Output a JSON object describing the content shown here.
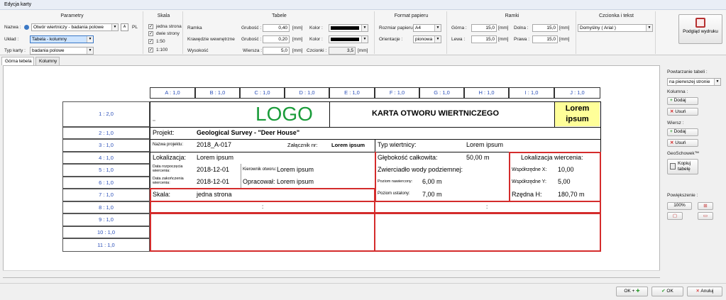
{
  "window": {
    "title": "Edycja karty"
  },
  "parametry": {
    "title": "Parametry",
    "nazwa_label": "Nazwa :",
    "nazwa_value": "Otwór wiertniczy - badania polowe",
    "pl": "PL",
    "uklad_label": "Układ :",
    "uklad_value": "Tabela - kolumny",
    "typ_label": "Typ karty :",
    "typ_value": "badania polowe"
  },
  "skala": {
    "title": "Skala",
    "items": [
      {
        "label": "jedna strona",
        "checked": true
      },
      {
        "label": "dwie strony",
        "checked": true
      },
      {
        "label": "1:50",
        "checked": true
      },
      {
        "label": "1:100",
        "checked": true
      }
    ]
  },
  "tabele": {
    "title": "Tabele",
    "ramka": "Ramka",
    "krawedzie": "Krawędzie wewnętrzne",
    "wysokosc": "Wysokość",
    "grubosc_label": "Grubość :",
    "grubosc1": "0,40",
    "grubosc2": "0,20",
    "wiersza_label": "Wiersza :",
    "wiersza": "5,0",
    "unit": "[mm]",
    "kolor_label": "Kolor :",
    "czcionki_label": "Czcionki :",
    "czcionki": "3,5",
    "color": "#000000"
  },
  "format": {
    "title": "Format papieru",
    "rozmiar_label": "Rozmiar papieru :",
    "rozmiar": "A4",
    "orientacja_label": "Orientacje :",
    "orientacja": "pionowa"
  },
  "ramki": {
    "title": "Ramki",
    "gora_label": "Górna :",
    "gora": "15,0",
    "dolna_label": "Dolna :",
    "dolna": "15,0",
    "lewa_label": "Lewa :",
    "lewa": "15,0",
    "prawa_label": "Prawa :",
    "prawa": "15,0",
    "unit": "[mm]"
  },
  "czcionka": {
    "title": "Czcionka i tekst",
    "value": "Domyślny ( Arial )"
  },
  "podglad": {
    "label": "Podgląd wydruku"
  },
  "tabs": [
    {
      "label": "Górna tebela"
    },
    {
      "label": "Kolumny"
    }
  ],
  "sheet": {
    "columns": [
      "A : 1,0",
      "B : 1,0",
      "C : 1,0",
      "D : 1,0",
      "E : 1,0",
      "F : 1,0",
      "G : 1,0",
      "H : 1,0",
      "I : 1,0",
      "J : 1,0"
    ],
    "rows": [
      "1 : 2,0",
      "2 : 1,0",
      "3 : 1,0",
      "4 : 1,0",
      "5 : 1,0",
      "6 : 1,0",
      "7 : 1,0",
      "8 : 1,0",
      "9 : 1,0",
      "10 : 1,0",
      "11 : 1,0"
    ],
    "small_mark": ",,",
    "logo": "LOGO",
    "card_title": "KARTA OTWORU WIERTNICZEGO",
    "lorem_box": "Lorem ipsum",
    "projekt_label": "Projekt:",
    "projekt_value": "Geological Survey - \"Deer House\"",
    "nazwa_projektu_label": "Nazwa projektu:",
    "nazwa_projektu_value": "2018_A-017",
    "zalacznik_label": "Załącznik nr:",
    "zalacznik_value": "Lorem ipsum",
    "typ_wiertnicy_label": "Typ wiertnicy:",
    "typ_wiertnicy_value": "Lorem ipsum",
    "lokalizacja_label": "Lokalizacja:",
    "lokalizacja_value": "Lorem ipsum",
    "glebokosc_label": "Głębokość całkowita:",
    "glebokosc_value": "50,00 m",
    "lok_wiercenia_label": "Lokalizacja wiercenia:",
    "data_rozp_label": "Data rozpoczęcia wiercenia:",
    "data_rozp_value": "2018-12-01",
    "kierownik_label": "Kierownik otworu:",
    "kierownik_value": "Lorem ipsum",
    "zwierciadlo_label": "Zwierciadło wody podziemnej:",
    "wsp_x_label": "Współrzędne X:",
    "wsp_x_value": "10,00",
    "data_zak_label": "Data zakończenia wiercenia:",
    "data_zak_value": "2018-12-01",
    "opracowal_label": "Opracował:",
    "opracowal_value": "Lorem ipsum",
    "poziom_naw_label": "Poziom nawiercony:",
    "poziom_naw_value": "6,00 m",
    "wsp_y_label": "Współrzędne Y:",
    "wsp_y_value": "5,00",
    "skala_label": "Skala:",
    "skala_value": "jedna strona",
    "poziom_ust_label": "Poziom ustalony:",
    "poziom_ust_value": "7,00 m",
    "rzedna_label": "Rzędna H:",
    "rzedna_value": "180,70 m",
    "colon": ":"
  },
  "side": {
    "powtarzanie_label": "Powtarzanie tabeli :",
    "powtarzanie_value": "na pierwszej stronie",
    "kolumna_label": "Kolumna :",
    "dodaj": "Dodaj",
    "usun": "Usuń",
    "wiersz_label": "Wiersz :",
    "geo_label": "GeoSchowek™",
    "kopiuj": "Kopiuj tabelę",
    "powiekszenie_label": "Powiększenie :",
    "zoom": "100%"
  },
  "footer": {
    "ok_plus": "OK +",
    "ok": "OK",
    "anuluj": "Anuluj"
  }
}
